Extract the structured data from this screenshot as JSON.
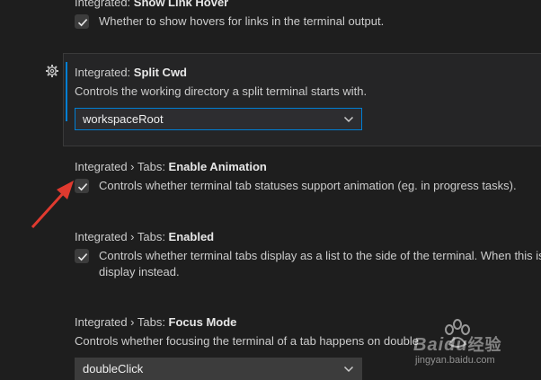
{
  "settings": [
    {
      "category": "Integrated: ",
      "name": "Show Link Hover",
      "description": "Whether to show hovers for links in the terminal output.",
      "checked": true
    },
    {
      "category": "Integrated: ",
      "name": "Split Cwd",
      "description": "Controls the working directory a split terminal starts with.",
      "value": "workspaceRoot"
    },
    {
      "category": "Integrated › Tabs: ",
      "name": "Enable Animation",
      "description": "Controls whether terminal tab statuses support animation (eg. in progress tasks).",
      "checked": true
    },
    {
      "category": "Integrated › Tabs: ",
      "name": "Enabled",
      "description_line1": "Controls whether terminal tabs display as a list to the side of the terminal. When this is",
      "description_line2": "display instead.",
      "checked": true
    },
    {
      "category": "Integrated › Tabs: ",
      "name": "Focus Mode",
      "description": "Controls whether focusing the terminal of a tab happens on double",
      "value": "doubleClick"
    }
  ],
  "icons": {
    "gear": "gear-icon",
    "check": "checkmark-icon",
    "chevron": "chevron-down-icon"
  },
  "watermark": {
    "brand": "Baidu",
    "chinese": "经验",
    "url": "jingyan.baidu.com"
  },
  "colors": {
    "background": "#1e1e1e",
    "focused_row": "#252526",
    "accent": "#007fd4",
    "annotation_arrow": "#e03a2f"
  }
}
